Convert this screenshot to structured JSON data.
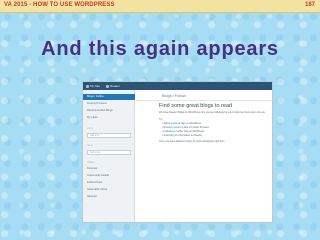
{
  "header": {
    "title": "VA 2015  -  HOW TO USE WORDPRESS",
    "slide_number": "187"
  },
  "slide": {
    "heading": "And this again appears"
  },
  "screenshot": {
    "topbar": {
      "my_site": "My Site",
      "reader": "Reader"
    },
    "sidebar": {
      "items": [
        {
          "label": "Blogs I Follow"
        },
        {
          "label": "Freshly Pressed"
        },
        {
          "label": "Recommended Blogs"
        },
        {
          "label": "My Likes"
        }
      ],
      "sections": [
        {
          "label": "Lists"
        },
        {
          "label": "Tags"
        },
        {
          "label": "Teams"
        }
      ],
      "inputs": [
        {
          "placeholder": "Add a list"
        },
        {
          "placeholder": "Add a tag"
        }
      ],
      "extra_items": [
        {
          "label": "Discover"
        },
        {
          "label": "Community Health"
        },
        {
          "label": "Follow Posts"
        },
        {
          "label": "Automattic News"
        },
        {
          "label": "Akismet"
        }
      ]
    },
    "main": {
      "title": "Blogs I Follow",
      "heading": "Find some great blogs to read",
      "intro": "We have Reader! Blogs on WordPress.com you are following for you to discover them when you are.",
      "intro2": "Try:",
      "bullets": [
        {
          "prefix": "Taking a",
          "link": "look at tags",
          "suffix": "on WordPress"
        },
        {
          "prefix": "",
          "link": "Browsing posts by",
          "suffix": "date in Freshly Pressed"
        },
        {
          "prefix": "",
          "link": "Following a",
          "suffix": "Twitter blog on WordPress"
        },
        {
          "prefix": "",
          "link": "Searching for",
          "suffix": "information on Reader"
        }
      ],
      "footer": "Once you have followed a blog, its posts will appear right here."
    }
  }
}
